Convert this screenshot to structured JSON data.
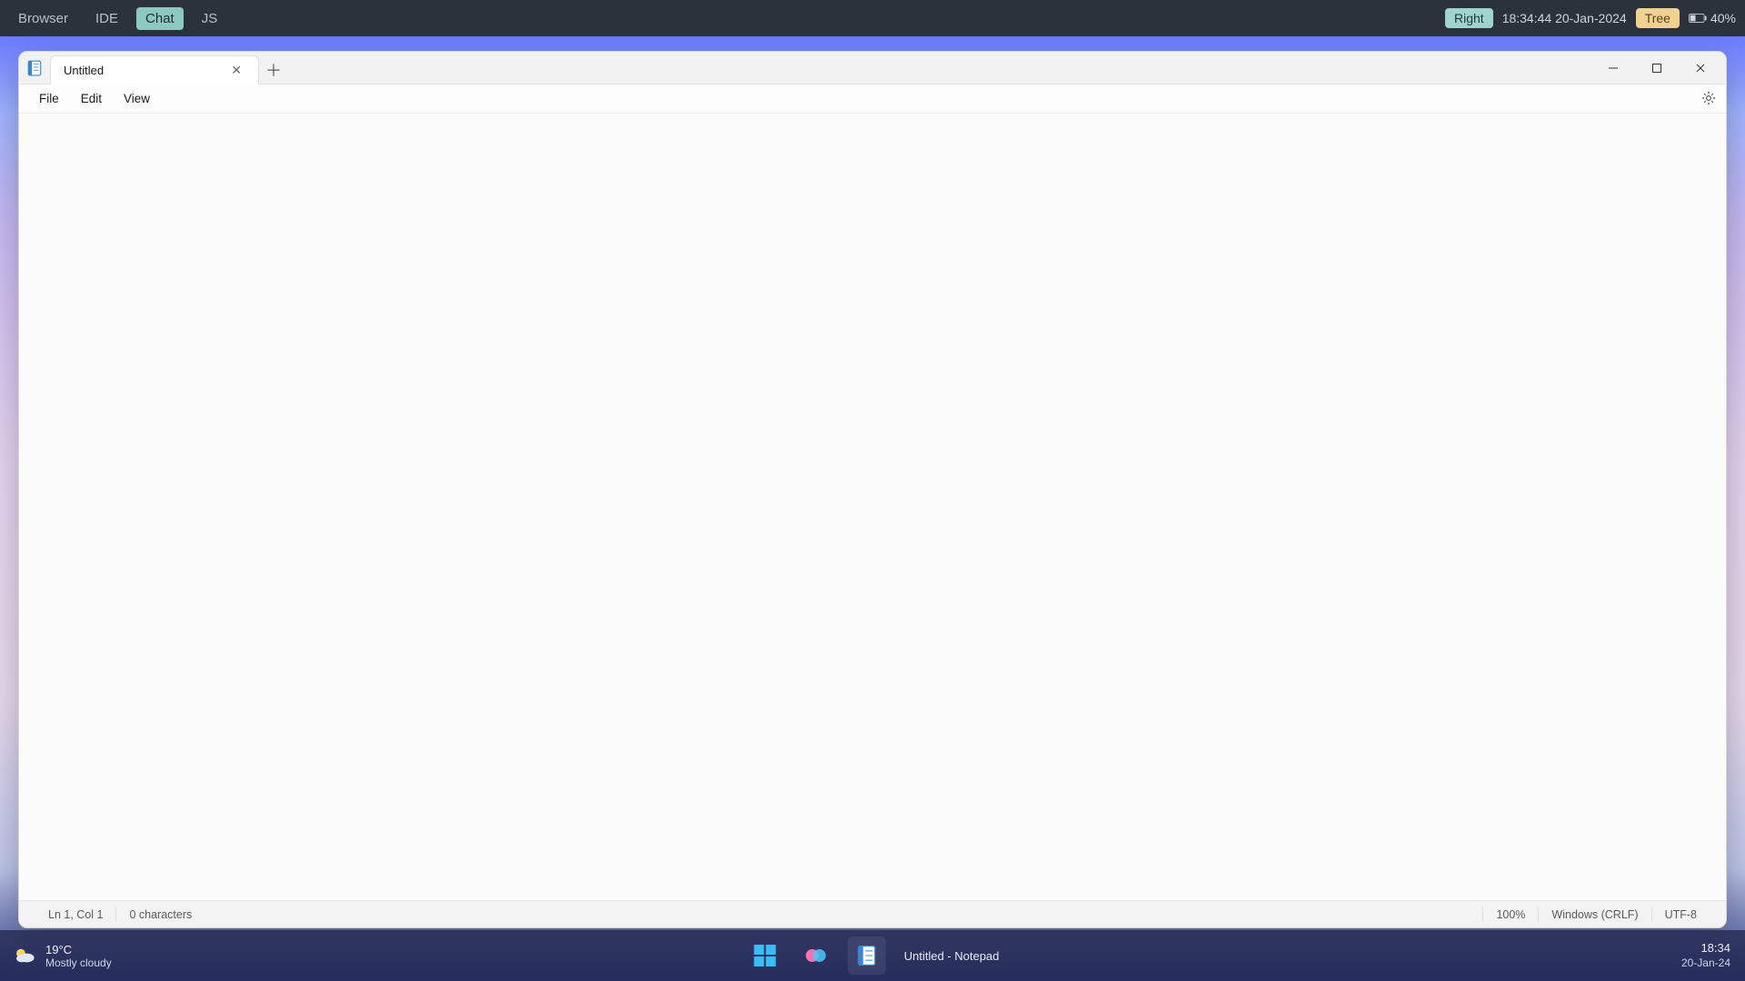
{
  "hostbar": {
    "tabs": [
      "Browser",
      "IDE",
      "Chat",
      "JS"
    ],
    "active_tab_index": 2,
    "right_pill": "Right",
    "datetime": "18:34:44 20-Jan-2024",
    "tree_pill": "Tree",
    "battery_pct": "40%"
  },
  "window": {
    "tab_title": "Untitled",
    "menu": {
      "file": "File",
      "edit": "Edit",
      "view": "View"
    },
    "editor_value": "",
    "status": {
      "pos": "Ln 1, Col 1",
      "chars": "0 characters",
      "zoom": "100%",
      "eol": "Windows (CRLF)",
      "encoding": "UTF-8"
    }
  },
  "taskbar": {
    "weather_temp": "19°C",
    "weather_cond": "Mostly cloudy",
    "active_app_label": "Untitled - Notepad",
    "time": "18:34",
    "date": "20-Jan-24"
  }
}
